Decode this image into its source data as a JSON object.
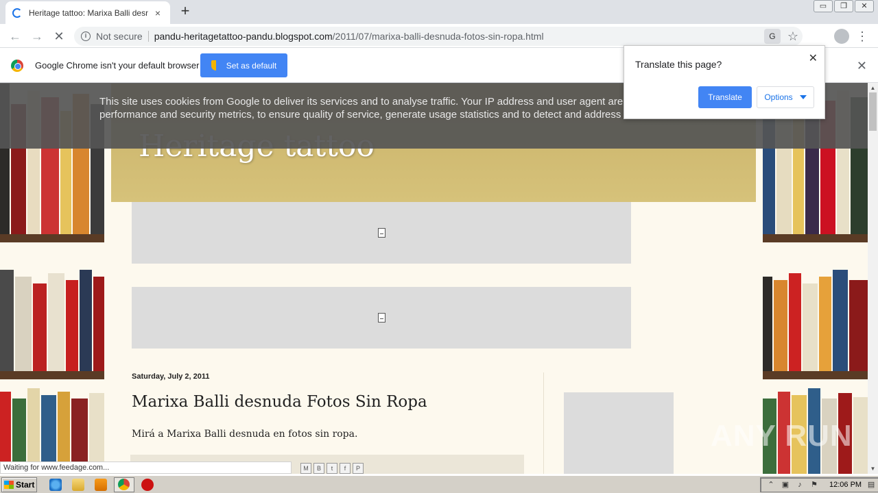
{
  "browser": {
    "tab_title": "Heritage tattoo: Marixa Balli desnuda Fotos Sin Ropa",
    "tab_close": "×",
    "new_tab": "+",
    "window_buttons": [
      "▭",
      "❐",
      "✕"
    ],
    "security_label": "Not secure",
    "url_host": "pandu-heritagetattoo-pandu.blogspot.com",
    "url_path": "/2011/07/marixa-balli-desnuda-fotos-sin-ropa.html",
    "back_glyph": "←",
    "forward_glyph": "→",
    "stop_glyph": "✕",
    "star_glyph": "☆",
    "menu_glyph": "⋮",
    "translate_glyph": "G"
  },
  "infobar": {
    "message": "Google Chrome isn't your default browser",
    "button_label": "Set as default",
    "close_glyph": "✕"
  },
  "translate_popup": {
    "title": "Translate this page?",
    "close_glyph": "✕",
    "translate_label": "Translate",
    "options_label": "Options"
  },
  "cookie_banner": {
    "text": "This site uses cookies from Google to deliver its services and to analyse traffic. Your IP address and user agent are shared with Google, together with performance and security metrics, to ensure quality of service, generate usage statistics and to detect and address abuse."
  },
  "blog": {
    "title": "Heritage tattoo",
    "post_date": "Saturday, July 2, 2011",
    "post_title": "Marixa Balli desnuda Fotos Sin Ropa",
    "post_body": "Mirá a Marixa Balli desnuda en fotos sin ropa.",
    "share_icons": [
      "M",
      "B",
      "t",
      "f",
      "P"
    ]
  },
  "status_bar": {
    "text": "Waiting for www.feedage.com..."
  },
  "watermark": {
    "text": "ANY RUN"
  },
  "taskbar": {
    "start_label": "Start",
    "clock": "12:06 PM",
    "tray_icons": [
      "⌃",
      "▣",
      "♪",
      "⚑",
      "▤"
    ]
  },
  "colors": {
    "accent_blue": "#4285f4",
    "header_gold": "#cdb56c",
    "page_cream": "#fdf9ee",
    "cookie_gray": "#555555"
  }
}
